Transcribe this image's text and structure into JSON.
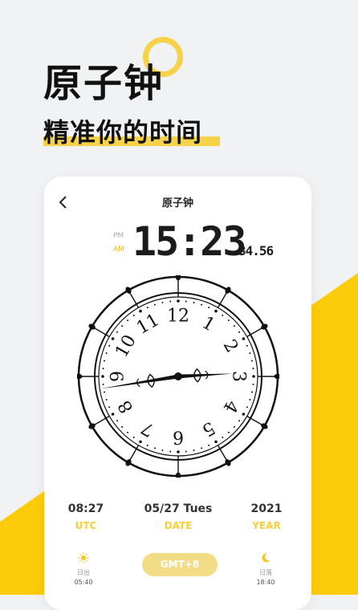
{
  "promo": {
    "title": "原子钟",
    "subtitle": "精准你的时间"
  },
  "app": {
    "nav_title": "原子钟",
    "period_pm": "PM",
    "period_am": "AM",
    "active_period": "AM",
    "time_main": "15:23",
    "time_seconds": "34.56"
  },
  "clock_face": {
    "numerals": [
      "12",
      "1",
      "2",
      "3",
      "4",
      "5",
      "6",
      "7",
      "8",
      "9",
      "10",
      "11"
    ],
    "hour_hand_value": 2.9,
    "minute_hand_value": 43.5
  },
  "info": {
    "utc_value": "08:27",
    "utc_label": "UTC",
    "date_value": "05/27 Tues",
    "date_label": "DATE",
    "year_value": "2021",
    "year_label": "YEAR"
  },
  "sun": {
    "sunrise_label": "日出",
    "sunrise_time": "05:40",
    "sunset_label": "日落",
    "sunset_time": "18:40"
  },
  "timezone_button": "GMT+8",
  "colors": {
    "accent_yellow": "#f7d349",
    "background": "#f1f2f4",
    "dark": "#1b1b1b"
  }
}
